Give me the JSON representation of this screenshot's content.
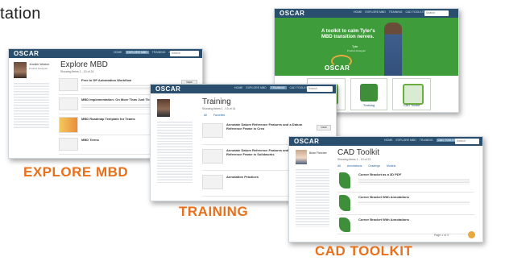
{
  "page": {
    "heading": "tation"
  },
  "colors": {
    "navbar": "#2a4f6e",
    "accent_orange": "#e8701a",
    "hero_green": "#3e9c3b"
  },
  "captions": {
    "explore": "EXPLORE MBD",
    "training": "TRAINING",
    "cad": "CAD TOOLKIT"
  },
  "windows": {
    "home": {
      "logo": "OSCAR",
      "nav": [
        "HOME",
        "EXPLORE MBD",
        "TRAINING",
        "CAD TOOLKIT"
      ],
      "search_placeholder": "Search",
      "hero_text": "A toolkit to calm Tyler's MBD transition nerves.",
      "hero_person_name": "Tyler",
      "hero_person_role": "Product Designer",
      "hero_brand": "OSCAR",
      "tiles": [
        {
          "label": "Explore MBD",
          "icon": "book-icon"
        },
        {
          "label": "Training",
          "icon": "presenter-icon"
        },
        {
          "label": "CAD Toolkit",
          "icon": "toolkit-icon"
        }
      ]
    },
    "explore": {
      "logo": "OSCAR",
      "nav": [
        "HOME",
        "EXPLORE MBD",
        "TRAINING",
        "CAD TOOLKIT"
      ],
      "search_placeholder": "Search",
      "profile_name": "Jennifer Weston",
      "profile_role": "Product Designer",
      "title": "Explore MBD",
      "subtitle": "Showing items 1 - 10 of 24",
      "items": [
        {
          "title": "Free to DP Automation Workflow",
          "button": "VIEW"
        },
        {
          "title": "MBD Implementation: On More Than Just The Tool",
          "button": ""
        },
        {
          "title": "MBD Roadmap Template for Teams",
          "button": ""
        },
        {
          "title": "MBD Terms",
          "button": ""
        }
      ]
    },
    "training": {
      "logo": "OSCAR",
      "nav": [
        "HOME",
        "EXPLORE MBD",
        "TRAINING",
        "CAD TOOLKIT"
      ],
      "search_placeholder": "Search",
      "title": "Training",
      "subtitle": "Showing items 1 - 10 of 14",
      "tabs": [
        "All",
        "Favorites"
      ],
      "items": [
        {
          "title": "Annotate Datum Reference Features and a Datum Reference Frame in Creo",
          "button": "VIEW"
        },
        {
          "title": "Annotate Datum Reference Features and a Datum Reference Frame in Solidworks",
          "button": ""
        },
        {
          "title": "Annotation Practices",
          "button": ""
        }
      ]
    },
    "cad": {
      "logo": "OSCAR",
      "nav": [
        "HOME",
        "EXPLORE MBD",
        "TRAINING",
        "CAD TOOLKIT"
      ],
      "search_placeholder": "Search",
      "profile_name": "Brian Fletcher",
      "title": "CAD Toolkit",
      "subtitle": "Showing items 1 - 10 of 22",
      "tabs": [
        "All",
        "Annotations",
        "Drawings",
        "Models"
      ],
      "items": [
        {
          "title": "Corner Bracket as a 3D PDF"
        },
        {
          "title": "Corner Bracket With Annotations"
        },
        {
          "title": "Corner Bracket With Annotations"
        }
      ],
      "pager": "Page 1 of 3"
    }
  }
}
